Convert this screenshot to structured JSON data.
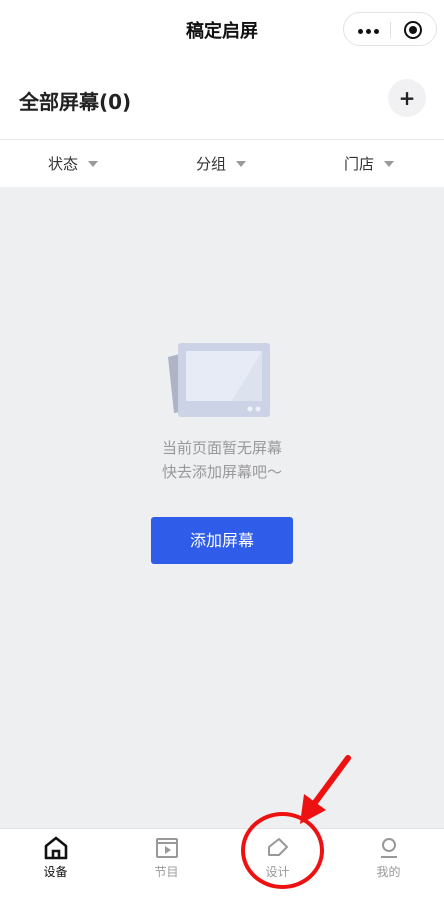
{
  "nav": {
    "title": "稿定启屏"
  },
  "header": {
    "title": "全部屏幕(0)",
    "add_label": "+"
  },
  "filters": [
    {
      "label": "状态"
    },
    {
      "label": "分组"
    },
    {
      "label": "门店"
    }
  ],
  "empty": {
    "line1": "当前页面暂无屏幕",
    "line2": "快去添加屏幕吧～",
    "button": "添加屏幕"
  },
  "tabs": [
    {
      "label": "设备",
      "icon": "home-icon",
      "active": true
    },
    {
      "label": "节目",
      "icon": "program-icon",
      "active": false
    },
    {
      "label": "设计",
      "icon": "design-icon",
      "active": false
    },
    {
      "label": "我的",
      "icon": "profile-icon",
      "active": false
    }
  ],
  "colors": {
    "accent": "#2f5ce8",
    "annotation": "#ee1111",
    "content_bg": "#eeeff1"
  }
}
